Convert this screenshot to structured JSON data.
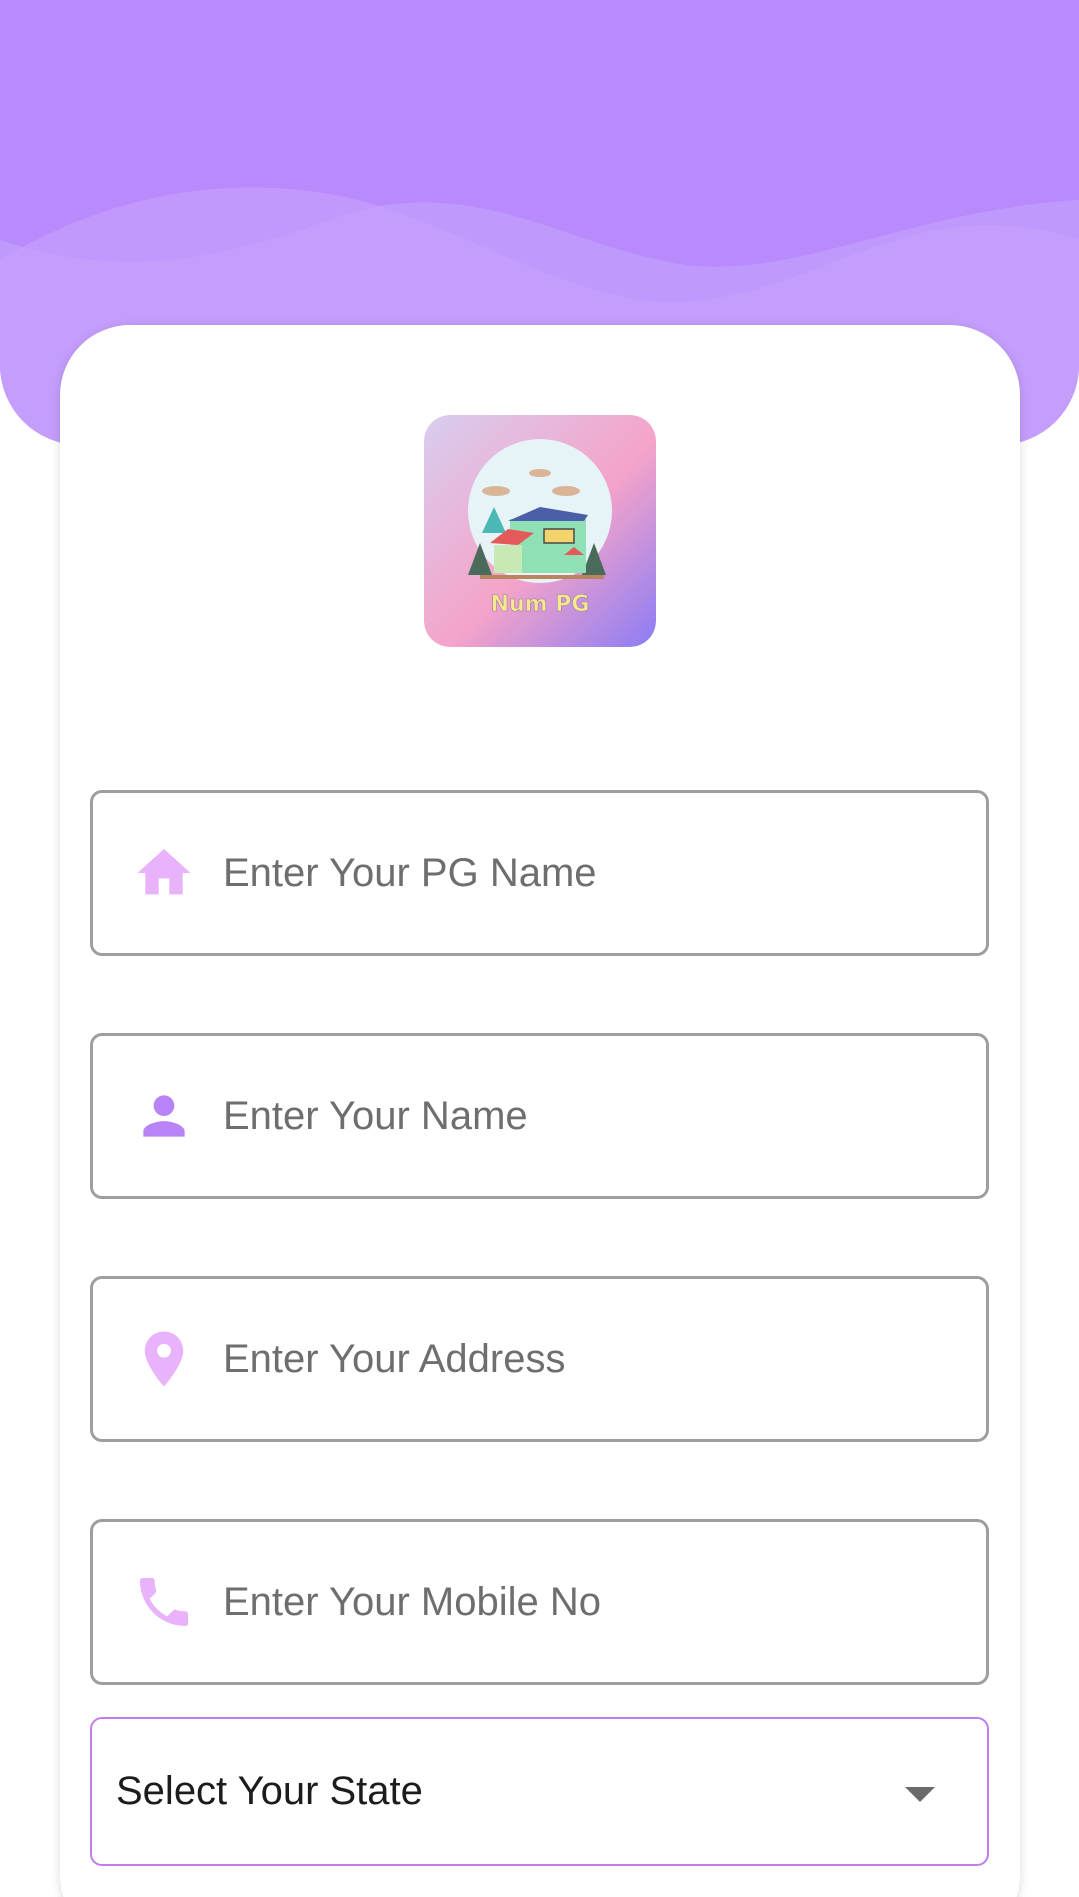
{
  "form": {
    "pg_name": {
      "placeholder": "Enter Your PG Name",
      "value": "",
      "icon": "home-icon"
    },
    "owner_name": {
      "placeholder": "Enter Your Name",
      "value": "",
      "icon": "person-icon"
    },
    "address": {
      "placeholder": "Enter Your Address",
      "value": "",
      "icon": "location-pin-icon"
    },
    "mobile": {
      "placeholder": "Enter Your Mobile No",
      "value": "",
      "icon": "phone-icon"
    },
    "state_select": {
      "label": "Select Your State",
      "icon": "dropdown-caret-icon"
    }
  },
  "logo": {
    "text": "Num PG"
  },
  "colors": {
    "header": "#b88afc",
    "icon_light": "#e9b3fb",
    "icon_dark": "#b983f8",
    "select_border": "#c27cf0",
    "field_border": "#9e9e9e"
  }
}
